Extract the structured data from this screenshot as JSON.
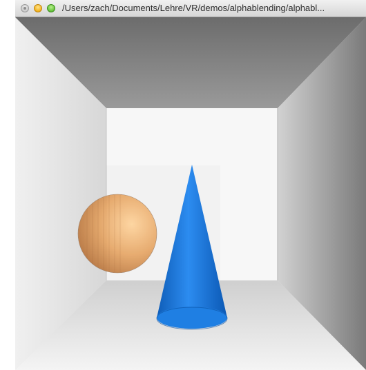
{
  "window": {
    "title": "/Users/zach/Documents/Lehre/VR/demos/alphablending/alphabl..."
  },
  "scene": {
    "objects": [
      "room",
      "translucent-sphere",
      "cone"
    ],
    "colors": {
      "cone": "#1f7fe3",
      "sphere": "#e7a866",
      "back_wall": "#f7f7f7",
      "ceiling": "#8a8a8a"
    }
  }
}
